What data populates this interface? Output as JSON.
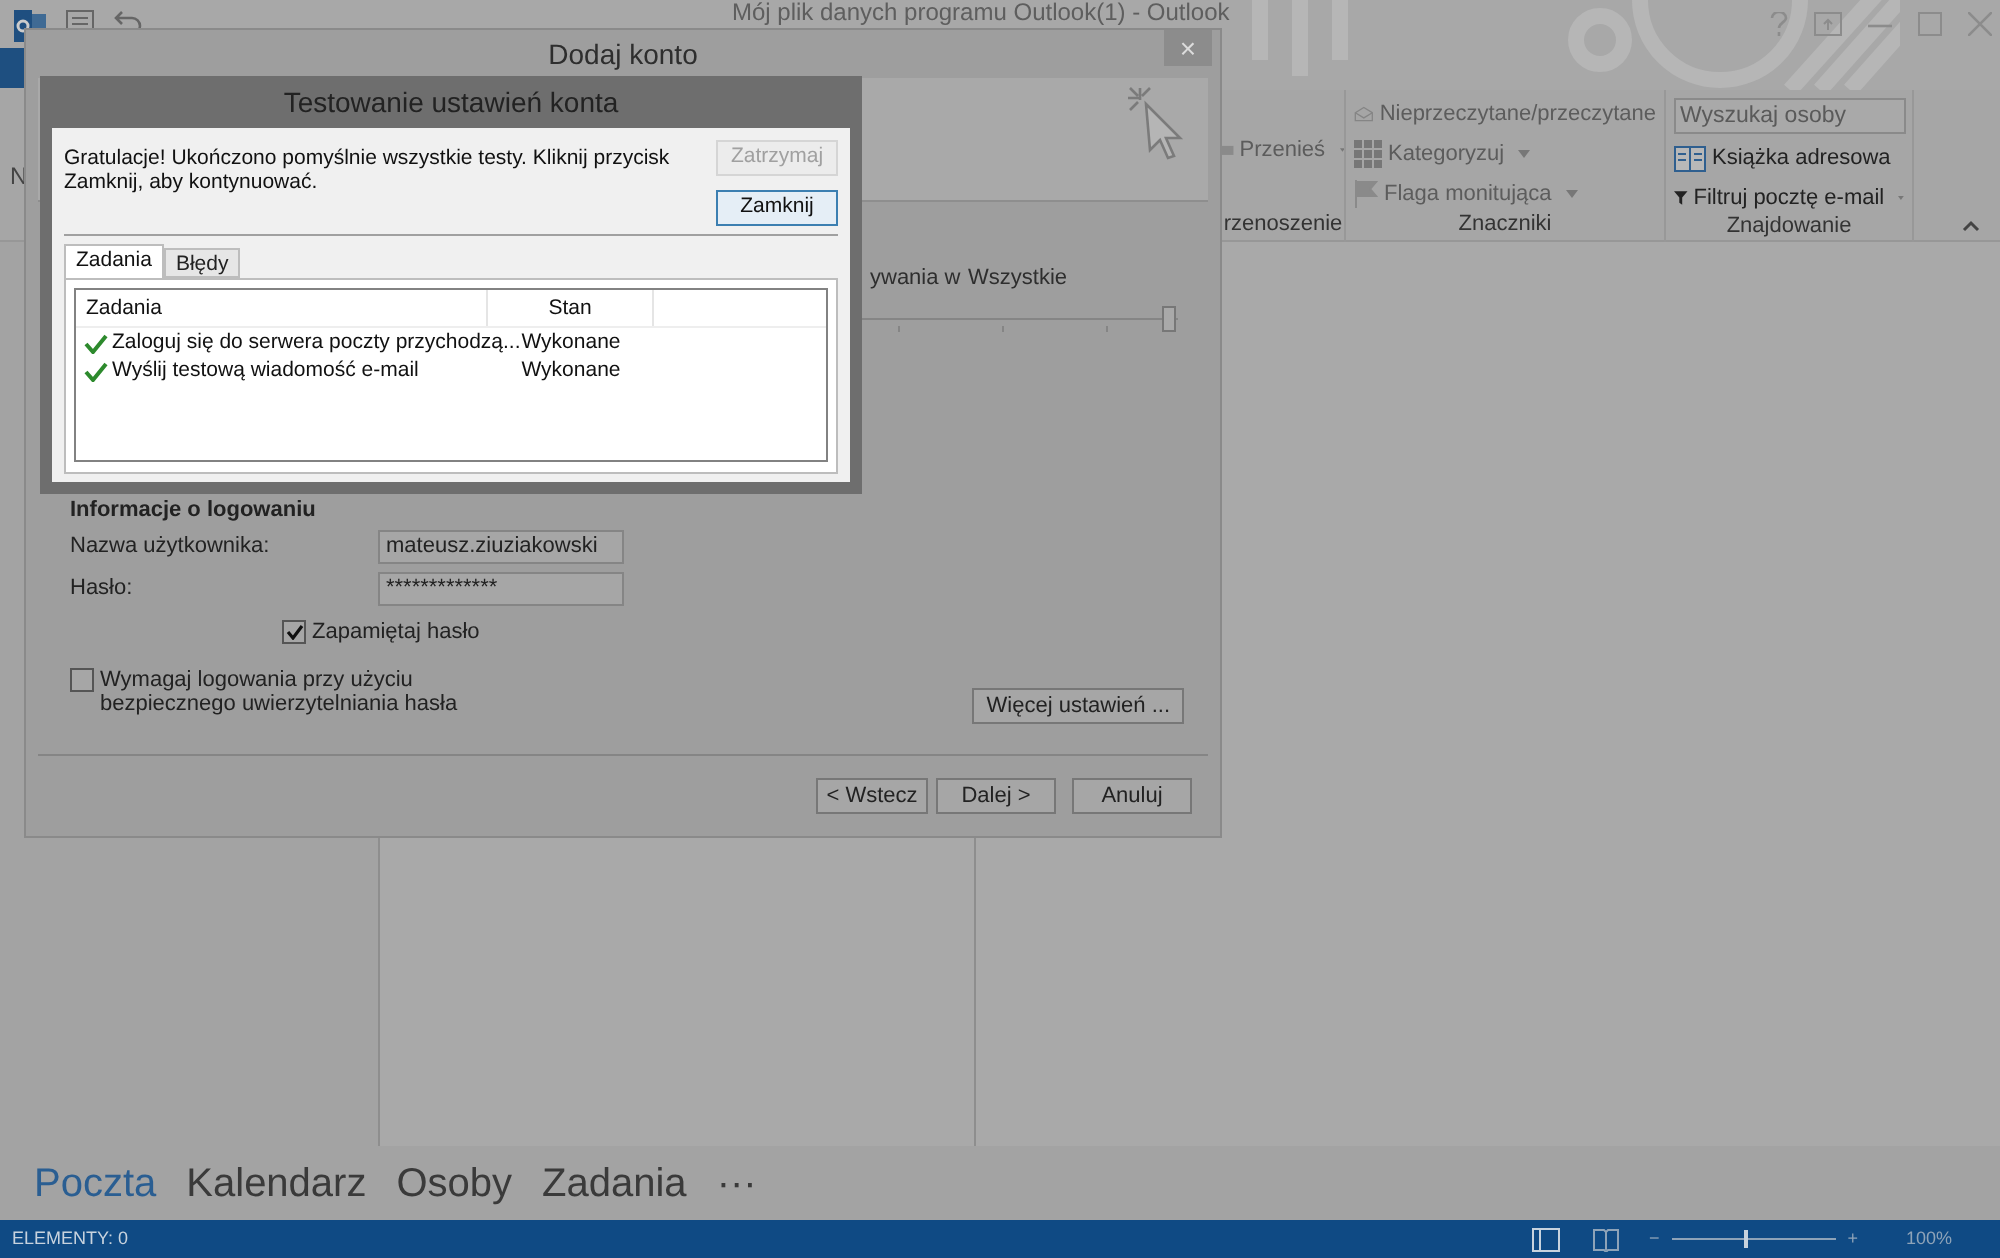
{
  "outlook": {
    "title": "Mój plik danych programu Outlook(1) - Outlook",
    "left_fragment": "N",
    "ribbon": {
      "groups": [
        {
          "label": "rzenoszenie",
          "items": [
            {
              "label": "Przenieś",
              "dropdown": true
            }
          ]
        },
        {
          "label": "Znaczniki",
          "items": [
            {
              "label": "Nieprzeczytane/przeczytane",
              "dropdown": false
            },
            {
              "label": "Kategoryzuj",
              "dropdown": true
            },
            {
              "label": "Flaga monitująca",
              "dropdown": true
            }
          ]
        },
        {
          "label": "Znajdowanie",
          "search": {
            "placeholder": "Wyszukaj osoby"
          },
          "items": [
            {
              "label": "Książka adresowa",
              "dropdown": false
            },
            {
              "label": "Filtruj pocztę e-mail",
              "dropdown": true
            }
          ]
        }
      ]
    },
    "nav": [
      {
        "label": "Poczta",
        "selected": true
      },
      {
        "label": "Kalendarz",
        "selected": false
      },
      {
        "label": "Osoby",
        "selected": false
      },
      {
        "label": "Zadania",
        "selected": false
      },
      {
        "label": "···",
        "selected": false
      }
    ],
    "status_bar": {
      "items": "ELEMENTY: 0",
      "zoom": {
        "zoom_out": "−",
        "zoom_in": "+",
        "level": 0.45,
        "reading": "100%"
      }
    }
  },
  "dialog": {
    "title": "Dodaj konto",
    "close": "×",
    "cut_label": "ywania w",
    "cut_value": "Wszystkie",
    "slider": {
      "level": 1
    },
    "section": "Informacje o logowaniu",
    "fields": [
      {
        "label": "Nazwa użytkownika:",
        "value": "mateusz.ziuziakowski"
      },
      {
        "label": "Hasło:",
        "value": "*************"
      }
    ],
    "remember": {
      "label": "Zapamiętaj hasło",
      "checked": true
    },
    "spa": {
      "label": "Wymagaj logowania przy użyciu bezpiecznego uwierzytelniania hasła",
      "checked": false
    },
    "more_button": "Więcej ustawień ...",
    "buttons": [
      "< Wstecz",
      "Dalej >",
      "Anuluj"
    ]
  },
  "test_dialog": {
    "title": "Testowanie ustawień konta",
    "message": "Gratulacje! Ukończono pomyślnie wszystkie testy. Kliknij przycisk Zamknij, aby kontynuować.",
    "buttons": [
      {
        "label": "Zatrzymaj",
        "disabled": true
      },
      {
        "label": "Zamknij",
        "disabled": false
      }
    ],
    "tabs": [
      {
        "label": "Zadania",
        "selected": true
      },
      {
        "label": "Błędy",
        "selected": false
      }
    ],
    "columns": [
      "Zadania",
      "Stan"
    ],
    "tasks": [
      {
        "name": "Zaloguj się do serwera poczty przychodzą...",
        "status": "Wykonane",
        "done": true
      },
      {
        "name": "Wyślij testową wiadomość e-mail",
        "status": "Wykonane",
        "done": true
      }
    ]
  }
}
